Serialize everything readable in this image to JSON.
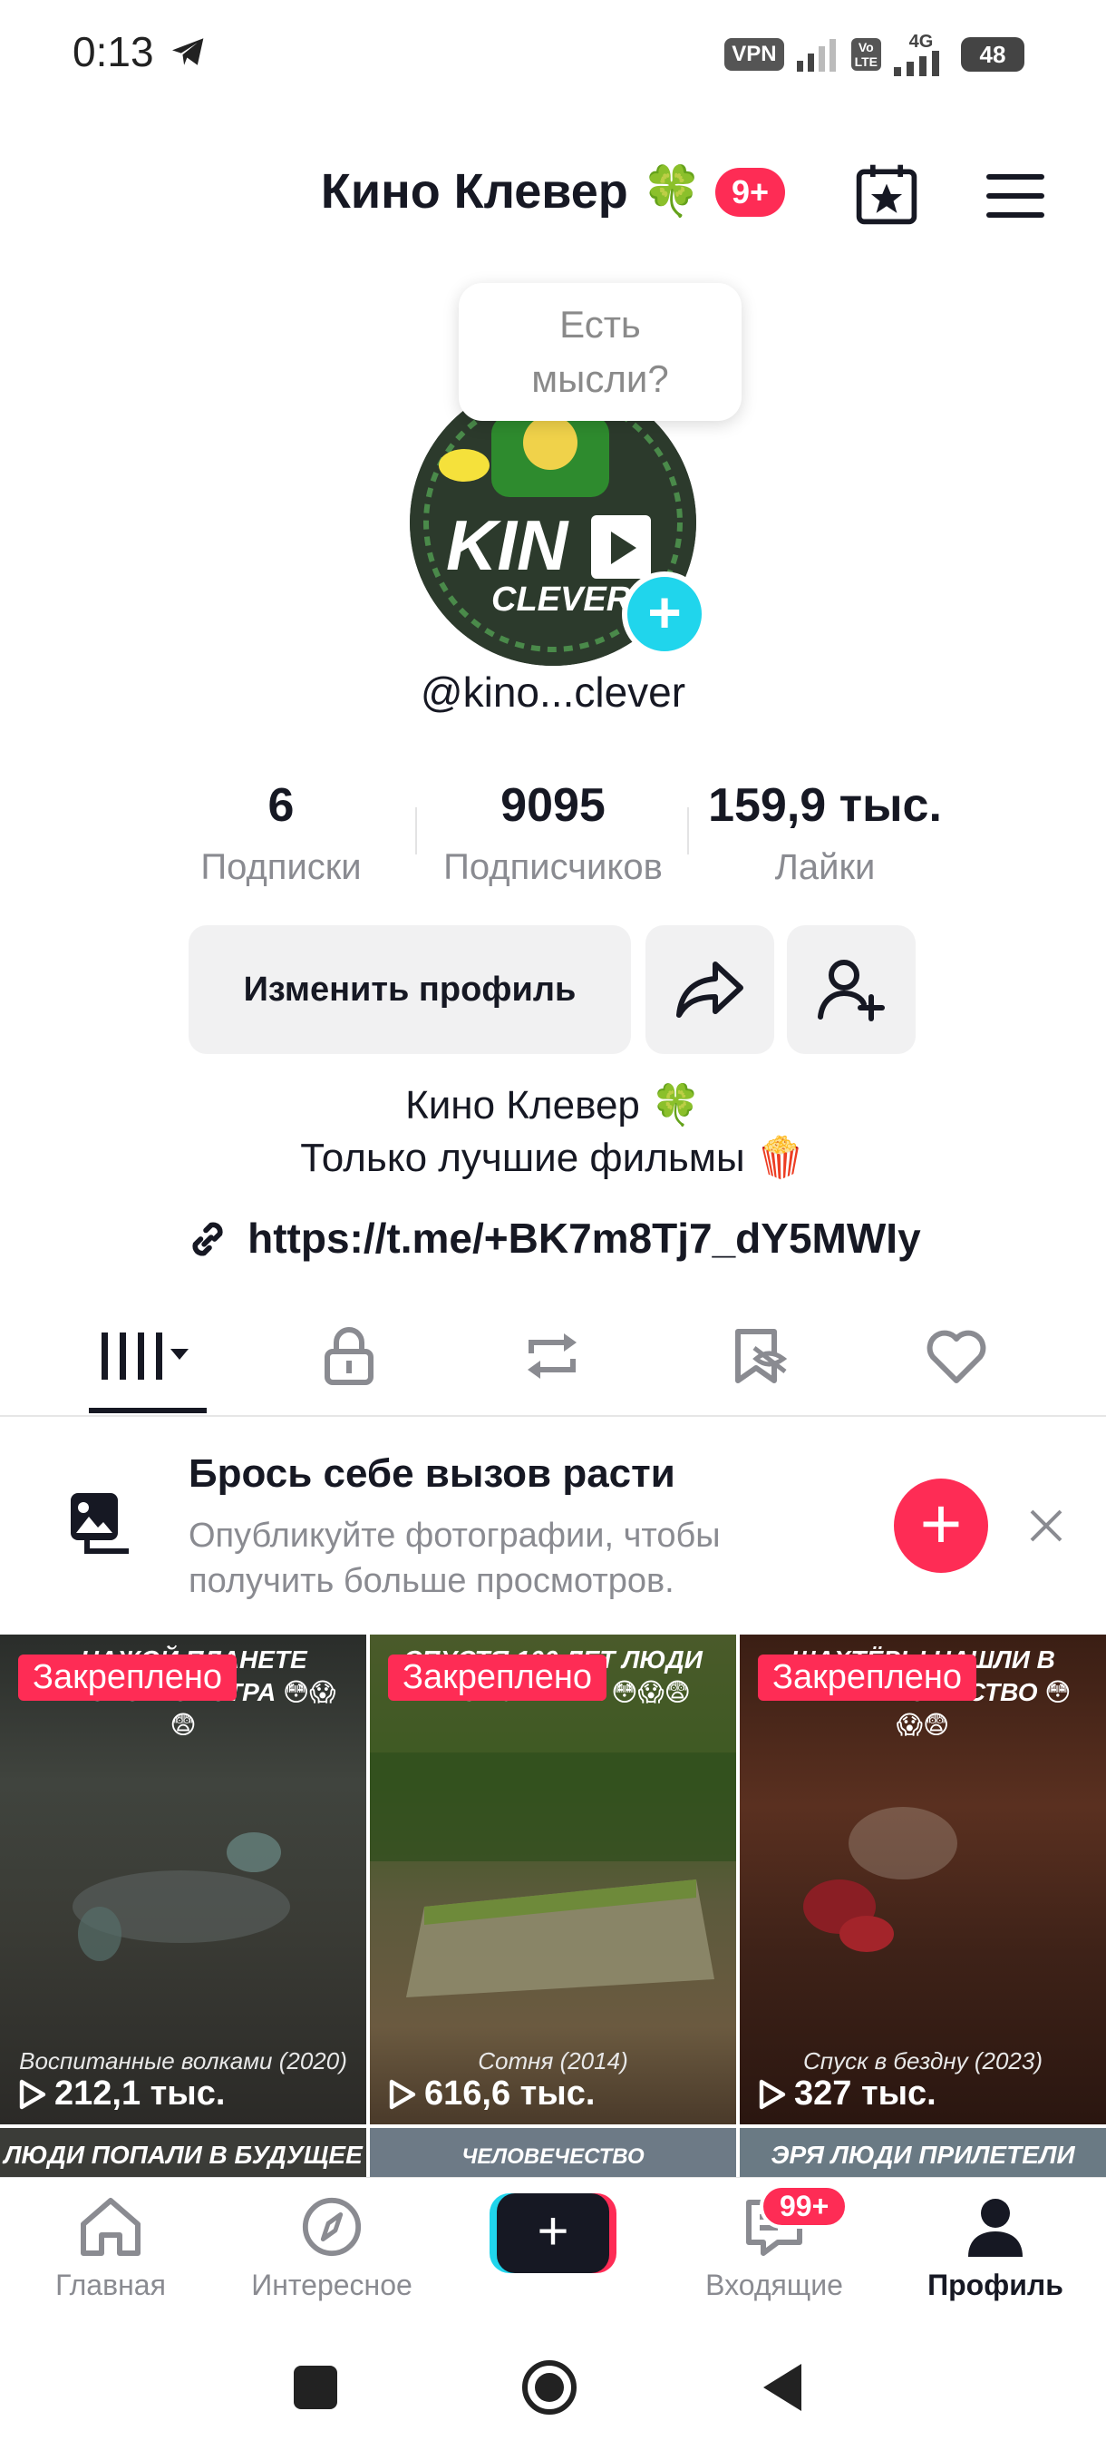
{
  "status_bar": {
    "time": "0:13",
    "vpn": "VPN",
    "volte_top": "Vo",
    "volte_bottom": "LTE",
    "network": "4G",
    "battery": "48"
  },
  "header": {
    "title": "Кино Клевер 🍀",
    "notif_badge": "9+"
  },
  "tooltip": {
    "line1": "Есть",
    "line2": "мысли?"
  },
  "avatar": {
    "logo_text_1": "KIN",
    "logo_text_2": "CLEVER"
  },
  "profile": {
    "handle": "@kino...clever"
  },
  "stats": [
    {
      "value": "6",
      "label": "Подписки"
    },
    {
      "value": "9095",
      "label": "Подписчиков"
    },
    {
      "value": "159,9 тыс.",
      "label": "Лайки"
    }
  ],
  "actions": {
    "edit_label": "Изменить профиль"
  },
  "bio": {
    "name": "Кино Клевер 🍀",
    "tagline": "Только лучшие фильмы 🍿",
    "link": "https://t.me/+BK7m8Tj7_dY5MWIy"
  },
  "promo": {
    "title": "Брось себе вызов расти",
    "subtitle": "Опубликуйте фотографии, чтобы получить больше просмотров."
  },
  "videos": [
    {
      "pinned": "Закреплено",
      "top_text": "...НАЖОЙ ПЛАНЕТЕ ...ННОГО МОНСТРА 😳😱😨",
      "caption": "Воспитанные волками (2020)",
      "views": "212,1 тыс."
    },
    {
      "pinned": "Закреплено",
      "top_text": "СПУСТЯ 100 ЛЕТ ЛЮДИ ... ИЗ БУНКЕРА 😳😱😨",
      "caption": "Сотня (2014)",
      "views": "616,6 тыс."
    },
    {
      "pinned": "Закреплено",
      "top_text": "ШАХТЁРЫ НАШЛИ В ...ЕВНЕЕ БОЖЕСТВО 😳😱😨",
      "caption": "Спуск в бездну (2023)",
      "views": "327 тыс."
    }
  ],
  "videos_row2": [
    {
      "top_text": "ЛЮДИ ПОПАЛИ В БУДУЩЕЕ"
    },
    {
      "top_text": "ЧЕЛОВЕЧЕСТВО ПЕРЕСЕЛИЛОСЬ"
    },
    {
      "top_text": "ЭРЯ ЛЮДИ ПРИЛЕТЕЛИ"
    }
  ],
  "bottom_nav": {
    "home": "Главная",
    "explore": "Интересное",
    "inbox": "Входящие",
    "inbox_badge": "99+",
    "profile": "Профиль"
  },
  "colors": {
    "accent": "#fe2c55",
    "cyan": "#20d5ec",
    "text": "#161823",
    "muted": "#8a8b91"
  }
}
